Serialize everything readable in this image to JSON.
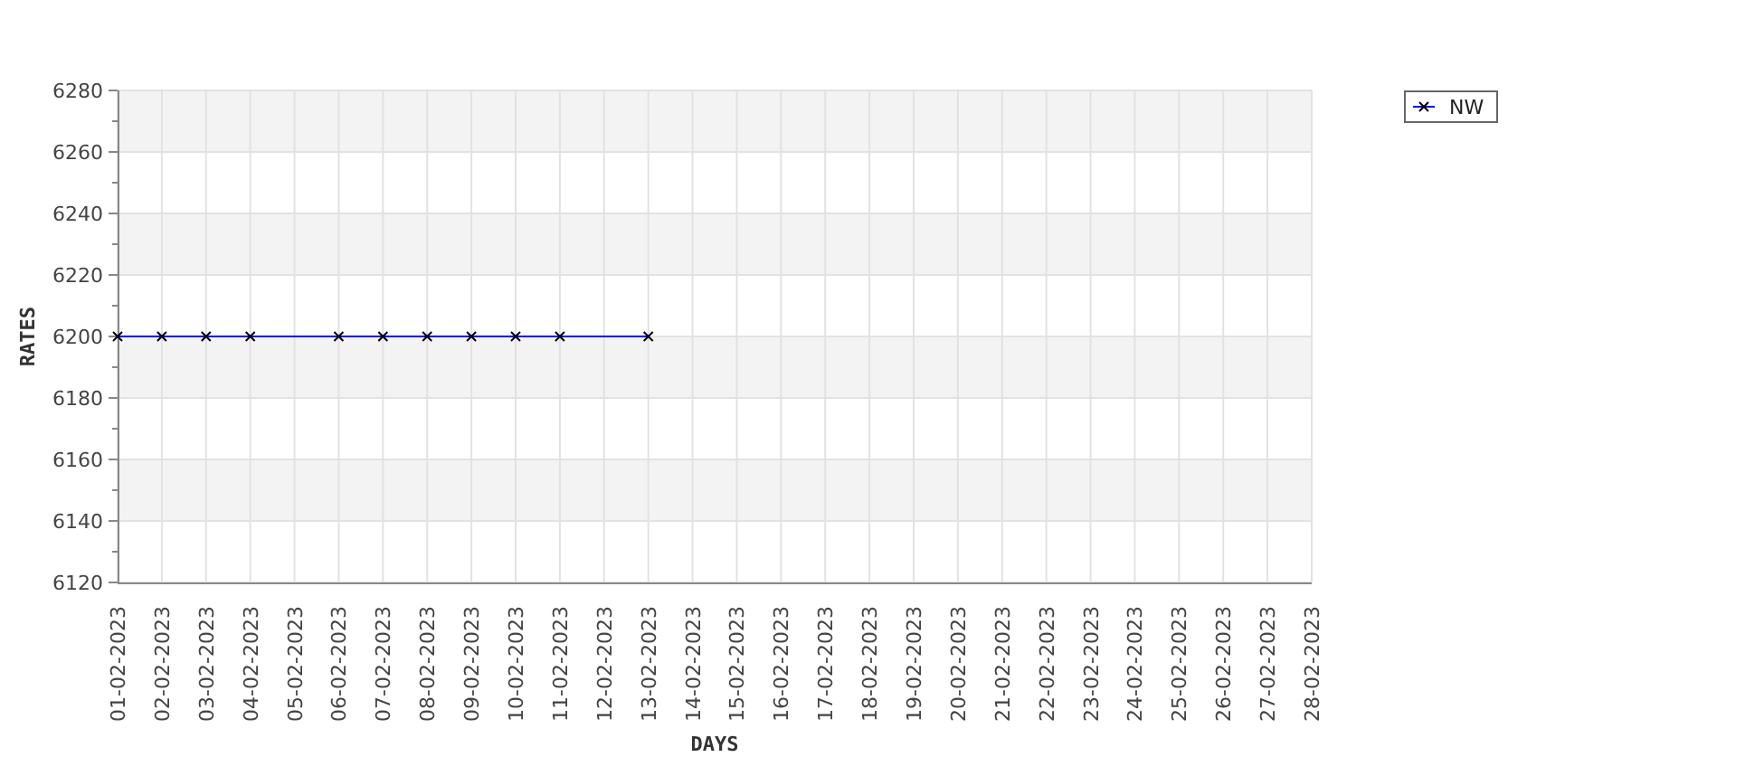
{
  "chart_data": {
    "type": "line",
    "grid": true,
    "xlabel": "DAYS",
    "ylabel": "RATES",
    "categories": [
      "01-02-2023",
      "02-02-2023",
      "03-02-2023",
      "04-02-2023",
      "05-02-2023",
      "06-02-2023",
      "07-02-2023",
      "08-02-2023",
      "09-02-2023",
      "10-02-2023",
      "11-02-2023",
      "12-02-2023",
      "13-02-2023",
      "14-02-2023",
      "15-02-2023",
      "16-02-2023",
      "17-02-2023",
      "18-02-2023",
      "19-02-2023",
      "20-02-2023",
      "21-02-2023",
      "22-02-2023",
      "23-02-2023",
      "24-02-2023",
      "25-02-2023",
      "26-02-2023",
      "27-02-2023",
      "28-02-2023"
    ],
    "series": [
      {
        "name": "NW",
        "color": "#0000ff",
        "marker": "x",
        "values": [
          6200,
          6200,
          6200,
          6200,
          null,
          6200,
          6200,
          6200,
          6200,
          6200,
          6200,
          null,
          6200,
          null,
          null,
          null,
          null,
          null,
          null,
          null,
          null,
          null,
          null,
          null,
          null,
          null,
          null,
          null
        ]
      }
    ],
    "ylim": [
      6120,
      6280
    ],
    "yticks": [
      6120,
      6140,
      6160,
      6180,
      6200,
      6220,
      6240,
      6260,
      6280
    ]
  }
}
